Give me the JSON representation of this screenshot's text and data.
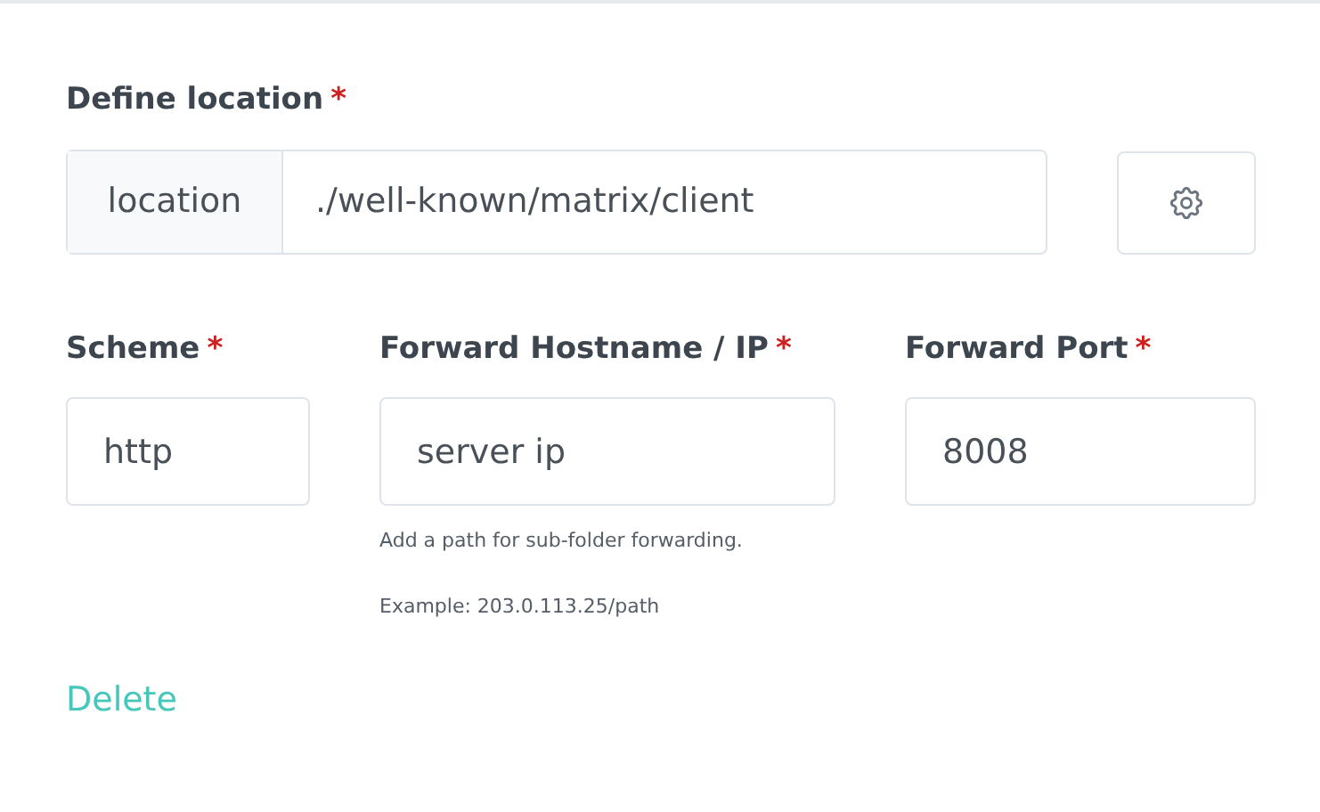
{
  "location": {
    "label": "Define location",
    "required_mark": "*",
    "addon": "location",
    "value": "./well-known/matrix/client"
  },
  "fields": [
    {
      "label": "Scheme",
      "required_mark": "*",
      "value": "http"
    },
    {
      "label": "Forward Hostname / IP",
      "required_mark": "*",
      "value": "server ip",
      "help": [
        "Add a path for sub-folder forwarding.",
        "Example: 203.0.113.25/path"
      ]
    },
    {
      "label": "Forward Port",
      "required_mark": "*",
      "value": "8008"
    }
  ],
  "delete_link": "Delete"
}
